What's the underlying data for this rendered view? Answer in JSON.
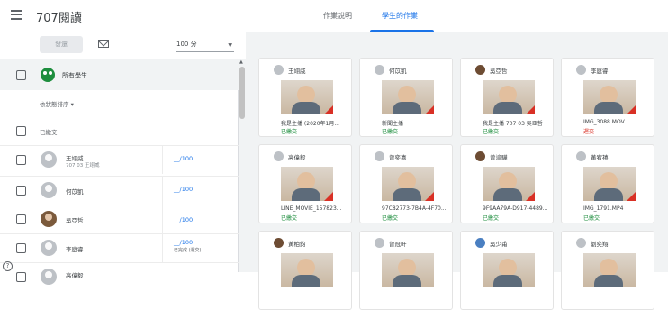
{
  "header": {
    "app_title": "707閱讀",
    "tabs": [
      {
        "label": "作業說明"
      },
      {
        "label": "學生的作業"
      }
    ]
  },
  "toolbar": {
    "return_label": "發還",
    "points_value": "100 分"
  },
  "left_panel": {
    "all_students_label": "所有學生",
    "sort_label": "依狀態排序 ▾",
    "submitted_label": "已繳交",
    "students": [
      {
        "name": "王翊威",
        "sub": "707 03 王翊威",
        "score": "__/100",
        "score_sub": ""
      },
      {
        "name": "何苡凱",
        "sub": "",
        "score": "__/100",
        "score_sub": ""
      },
      {
        "name": "吳亞哲",
        "sub": "",
        "score": "__/100",
        "score_sub": ""
      },
      {
        "name": "李庭睿",
        "sub": "",
        "score": "__/100",
        "score_sub": "已完成 (遲交)"
      },
      {
        "name": "高偉毅",
        "sub": "",
        "score": "",
        "score_sub": ""
      }
    ],
    "help_label": "?"
  },
  "cards": [
    {
      "name": "王翊威",
      "file": "我是主播 (2020年1月...",
      "status": "已繳交"
    },
    {
      "name": "何苡凱",
      "file": "新聞主播",
      "status": "已繳交"
    },
    {
      "name": "吳亞哲",
      "file": "我是主播 707 03 吳亞哲",
      "status": "已繳交"
    },
    {
      "name": "李庭睿",
      "file": "IMG_3088.MOV",
      "status": "遲交"
    },
    {
      "name": "高偉毅",
      "file": "LINE_MOVIE_157823...",
      "status": "已繳交"
    },
    {
      "name": "曾奕嘉",
      "file": "97C82773-7B4A-4F70...",
      "status": "已繳交"
    },
    {
      "name": "曾渝驊",
      "file": "9F9AA79A-D917-4489...",
      "status": "已繳交"
    },
    {
      "name": "黃宥禧",
      "file": "IMG_1791.MP4",
      "status": "已繳交"
    },
    {
      "name": "黃柏鈞",
      "file": "",
      "status": ""
    },
    {
      "name": "曾冠軒",
      "file": "",
      "status": ""
    },
    {
      "name": "吳少甫",
      "file": "",
      "status": ""
    },
    {
      "name": "劉奕翔",
      "file": "",
      "status": ""
    }
  ]
}
